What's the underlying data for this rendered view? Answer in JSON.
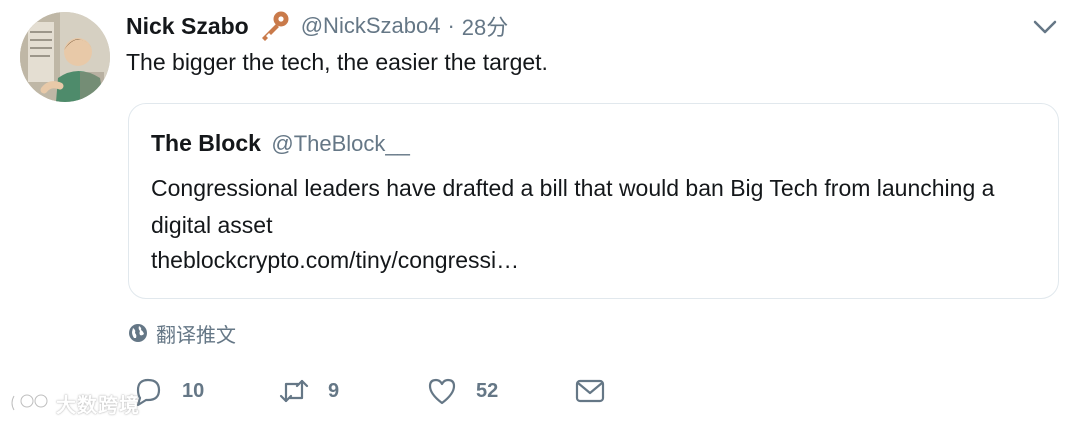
{
  "tweet": {
    "author_name": "Nick Szabo",
    "author_handle": "@NickSzabo4",
    "separator": "·",
    "time": "28分",
    "text": "The bigger the tech, the easier the target.",
    "badge_icon": "key-icon",
    "menu_icon": "chevron-down-icon"
  },
  "quoted_tweet": {
    "author_name": "The Block",
    "author_handle": "@TheBlock__",
    "text": "Congressional leaders have drafted a bill that would ban Big Tech from launching a digital asset",
    "link": "theblockcrypto.com/tiny/congressi…"
  },
  "translate": {
    "icon": "globe-icon",
    "label": "翻译推文"
  },
  "actions": {
    "reply": {
      "icon": "reply-icon",
      "count": "10"
    },
    "retweet": {
      "icon": "retweet-icon",
      "count": "9"
    },
    "like": {
      "icon": "heart-icon",
      "count": "52"
    },
    "message": {
      "icon": "envelope-icon"
    }
  },
  "watermark": {
    "text": "大数跨境"
  },
  "colors": {
    "text_primary": "#14171a",
    "text_secondary": "#657786",
    "card_border": "#e1e8ed",
    "key_badge": "#c97a4a"
  }
}
